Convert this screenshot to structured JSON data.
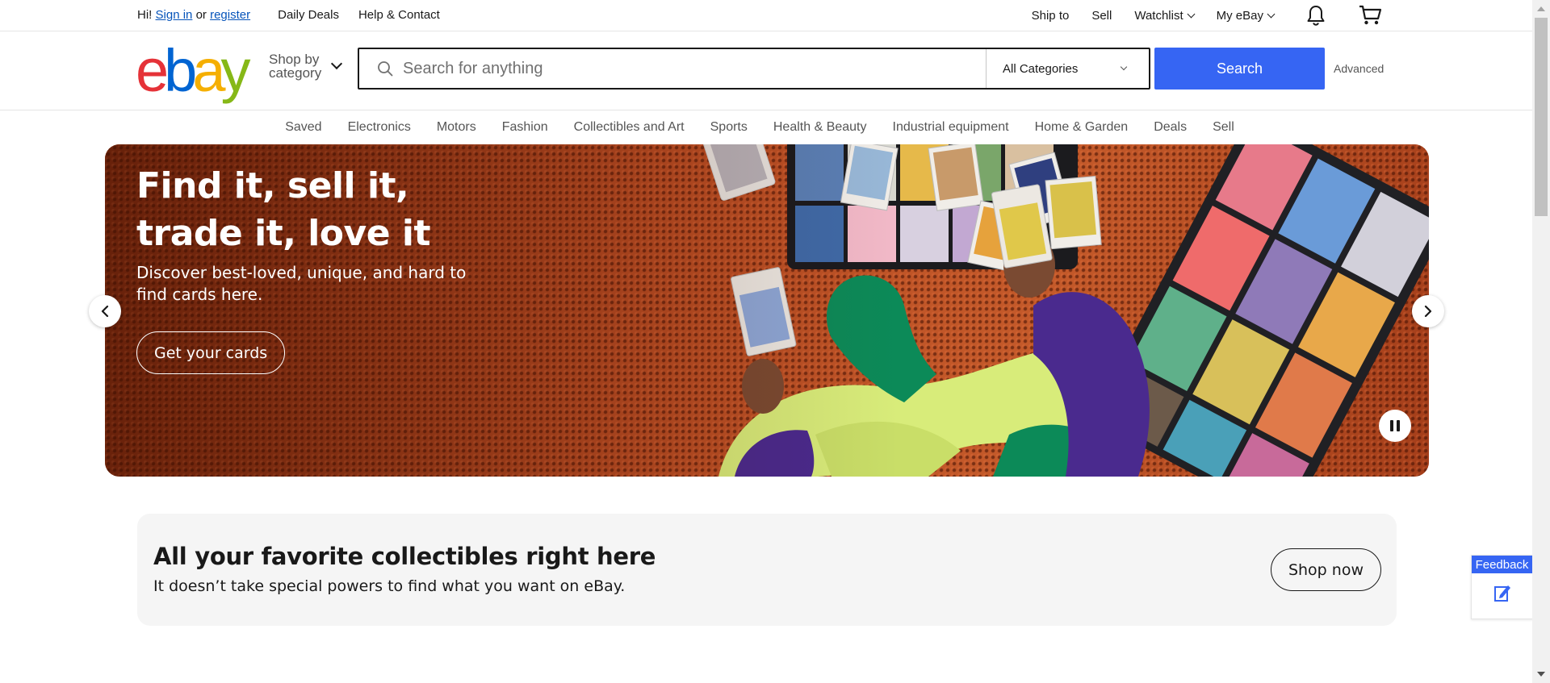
{
  "topbar": {
    "greeting": "Hi!",
    "sign_in": "Sign in",
    "or": "or",
    "register": "register",
    "daily_deals": "Daily Deals",
    "help_contact": "Help & Contact",
    "ship_to": "Ship to",
    "sell": "Sell",
    "watchlist": "Watchlist",
    "my_ebay": "My eBay",
    "icons": {
      "notifications": "bell-icon",
      "cart": "cart-icon"
    }
  },
  "header": {
    "logo": {
      "e": "e",
      "b": "b",
      "a": "a",
      "y": "y"
    },
    "shop_by_line1": "Shop by",
    "shop_by_line2": "category",
    "search_placeholder": "Search for anything",
    "category_selected": "All Categories",
    "search_button": "Search",
    "advanced": "Advanced"
  },
  "nav": {
    "items": [
      "Saved",
      "Electronics",
      "Motors",
      "Fashion",
      "Collectibles and Art",
      "Sports",
      "Health & Beauty",
      "Industrial equipment",
      "Home & Garden",
      "Deals",
      "Sell"
    ]
  },
  "hero": {
    "headline": "Find it, sell it, trade it, love it",
    "subtext": "Discover best-loved, unique, and hard to find cards here.",
    "cta": "Get your cards"
  },
  "promo": {
    "title": "All your favorite collectibles right here",
    "subtitle": "It doesn’t take special powers to find what you want on eBay.",
    "button": "Shop now"
  },
  "feedback": {
    "label": "Feedback"
  },
  "colors": {
    "brand_blue": "#3665f3",
    "link_blue": "#0654ba",
    "logo_red": "#e53238",
    "logo_blue": "#0064d2",
    "logo_yellow": "#f5af02",
    "logo_green": "#86b817",
    "hero_bg": "#a8421c"
  }
}
